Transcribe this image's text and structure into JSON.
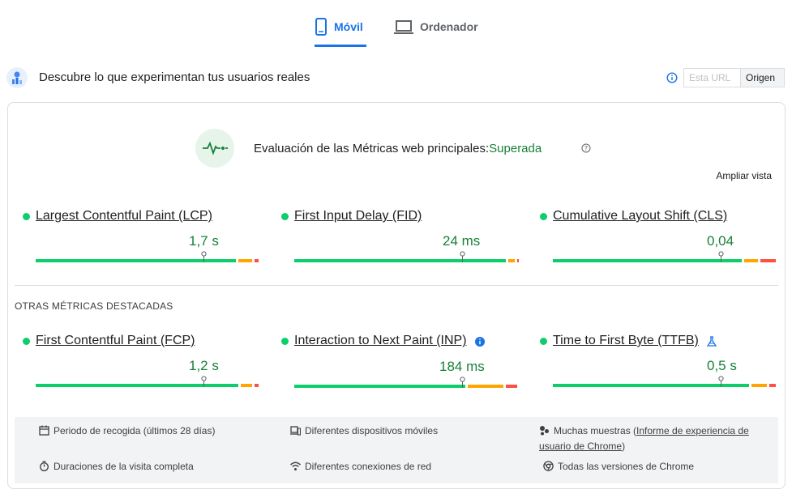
{
  "tabs": [
    {
      "label": "Móvil",
      "icon": "smartphone-icon",
      "selected": true
    },
    {
      "label": "Ordenador",
      "icon": "laptop-icon",
      "selected": false
    }
  ],
  "header": {
    "title": "Descubre lo que experimentan tus usuarios reales",
    "toggle_url": "Esta URL",
    "toggle_origin": "Origen"
  },
  "assessment": {
    "title": "Evaluación de las Métricas web principales:",
    "status": "Superada",
    "expand_label": "Ampliar vista"
  },
  "core_metrics": [
    {
      "name": "Largest Contentful Paint (LCP)",
      "value": "1,7 s",
      "marker": 0.745,
      "dist": [
        0.9,
        0.07,
        0.03
      ]
    },
    {
      "name": "First Input Delay (FID)",
      "value": "24 ms",
      "marker": 0.745,
      "dist": [
        0.95,
        0.04,
        0.01
      ]
    },
    {
      "name": "Cumulative Layout Shift (CLS)",
      "value": "0,04",
      "marker": 0.745,
      "dist": [
        0.85,
        0.07,
        0.08
      ]
    }
  ],
  "other_section_label": "OTRAS MÉTRICAS DESTACADAS",
  "other_metrics": [
    {
      "name": "First Contentful Paint (FCP)",
      "value": "1,2 s",
      "marker": 0.745,
      "dist": [
        0.91,
        0.06,
        0.03
      ],
      "extra_icon": null
    },
    {
      "name": "Interaction to Next Paint (INP)",
      "value": "184 ms",
      "marker": 0.745,
      "dist": [
        0.77,
        0.17,
        0.06
      ],
      "extra_icon": "info-icon"
    },
    {
      "name": "Time to First Byte (TTFB)",
      "value": "0,5 s",
      "marker": 0.745,
      "dist": [
        0.88,
        0.08,
        0.04
      ],
      "extra_icon": "experimental-flask-icon"
    }
  ],
  "footer": {
    "period": "Periodo de recogida (últimos 28 días)",
    "devices": "Diferentes dispositivos móviles",
    "samples_prefix": "Muchas muestras (",
    "samples_link": "Informe de experiencia de usuario de Chrome",
    "samples_suffix": ")",
    "durations": "Duraciones de la visita completa",
    "connections": "Diferentes conexiones de red",
    "chrome_versions": "Todas las versiones de Chrome"
  },
  "colors": {
    "accent": "#1a73e8",
    "good": "#0cce6b",
    "average": "#ffa400",
    "poor": "#ff4e42",
    "pass_text": "#188038"
  }
}
